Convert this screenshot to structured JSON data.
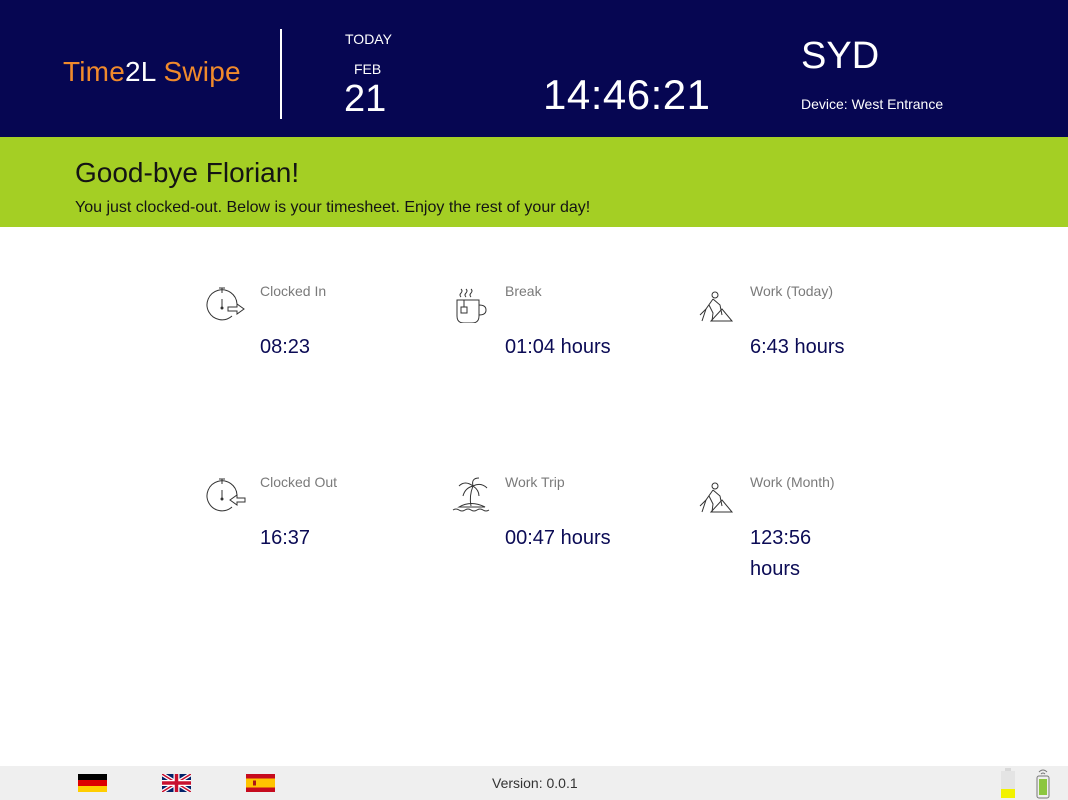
{
  "header": {
    "brand_part1": "Time",
    "brand_part2": "2L",
    "brand_part3": " Swipe",
    "today_label": "TODAY",
    "month": "FEB",
    "day": "21",
    "time": "14:46:21",
    "location": "SYD",
    "device": "Device: West Entrance"
  },
  "banner": {
    "title": "Good-bye Florian!",
    "message": "You just clocked-out. Below is your timesheet. Enjoy the rest of your day!"
  },
  "stats": [
    {
      "label": "Clocked In",
      "value": "08:23",
      "icon": "clock-in-icon"
    },
    {
      "label": "Break",
      "value": "01:04 hours",
      "icon": "coffee-cup-icon"
    },
    {
      "label": "Work (Today)",
      "value": "6:43 hours",
      "icon": "worker-icon"
    },
    {
      "label": "Clocked Out",
      "value": "16:37",
      "icon": "clock-out-icon"
    },
    {
      "label": "Work Trip",
      "value": "00:47 hours",
      "icon": "palm-island-icon"
    },
    {
      "label": "Work (Month)",
      "value": "123:56 hours",
      "icon": "worker-icon"
    }
  ],
  "footer": {
    "version": "Version: 0.0.1",
    "languages": [
      "de",
      "en",
      "es"
    ]
  },
  "colors": {
    "header_bg": "#060652",
    "banner_bg": "#a4cf24",
    "brand_accent": "#f08a2c",
    "value_text": "#0b0b55"
  },
  "battery_level": 0.35
}
